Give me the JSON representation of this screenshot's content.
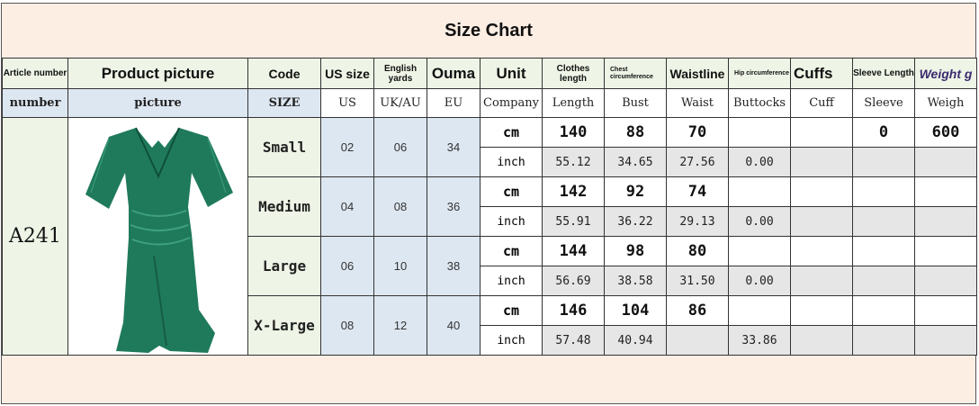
{
  "title": "Size Chart",
  "header1": {
    "article": "Article number",
    "picture": "Product picture",
    "code": "Code",
    "us": "US size",
    "english": "English yards",
    "ouma": "Ouma",
    "unit": "Unit",
    "clothes": "Clothes length",
    "chest": "Chest circumference",
    "waistline": "Waistline",
    "hip": "Hip circumference",
    "cuffs": "Cuffs",
    "sleeve": "Sleeve Length",
    "weight": "Weight g"
  },
  "header2": {
    "article": "number",
    "picture": "picture",
    "code": "SIZE",
    "us": "US",
    "english": "UK/AU",
    "ouma": "EU",
    "unit": "Company",
    "clothes": "Length",
    "chest": "Bust",
    "waistline": "Waist",
    "hip": "Buttocks",
    "cuffs": "Cuff",
    "sleeve": "Sleeve",
    "weight": "Weigh"
  },
  "article_number": "A241",
  "units": {
    "cm": "cm",
    "inch": "inch"
  },
  "rows": [
    {
      "size": "Small",
      "us": "02",
      "uk": "06",
      "eu": "34",
      "cm": {
        "length": "140",
        "bust": "88",
        "waist": "70",
        "hip": "",
        "cuff": "",
        "sleeve": "0",
        "weight": "600"
      },
      "inch": {
        "length": "55.12",
        "bust": "34.65",
        "waist": "27.56",
        "hip": "0.00"
      }
    },
    {
      "size": "Medium",
      "us": "04",
      "uk": "08",
      "eu": "36",
      "cm": {
        "length": "142",
        "bust": "92",
        "waist": "74",
        "hip": "",
        "cuff": "",
        "sleeve": "",
        "weight": ""
      },
      "inch": {
        "length": "55.91",
        "bust": "36.22",
        "waist": "29.13",
        "hip": "0.00"
      }
    },
    {
      "size": "Large",
      "us": "06",
      "uk": "10",
      "eu": "38",
      "cm": {
        "length": "144",
        "bust": "98",
        "waist": "80",
        "hip": "",
        "cuff": "",
        "sleeve": "",
        "weight": ""
      },
      "inch": {
        "length": "56.69",
        "bust": "38.58",
        "waist": "31.50",
        "hip": "0.00"
      }
    },
    {
      "size": "X-Large",
      "us": "08",
      "uk": "12",
      "eu": "40",
      "cm": {
        "length": "146",
        "bust": "104",
        "waist": "86",
        "hip": "",
        "cuff": "",
        "sleeve": "",
        "weight": ""
      },
      "inch": {
        "length": "57.48",
        "bust": "40.94",
        "waist": "",
        "hip": "33.86"
      }
    }
  ],
  "colors": {
    "dress": "#1f7a5c",
    "header_green": "#eef4e6",
    "cell_blue": "#dde7f1",
    "background": "#fdeee4"
  }
}
